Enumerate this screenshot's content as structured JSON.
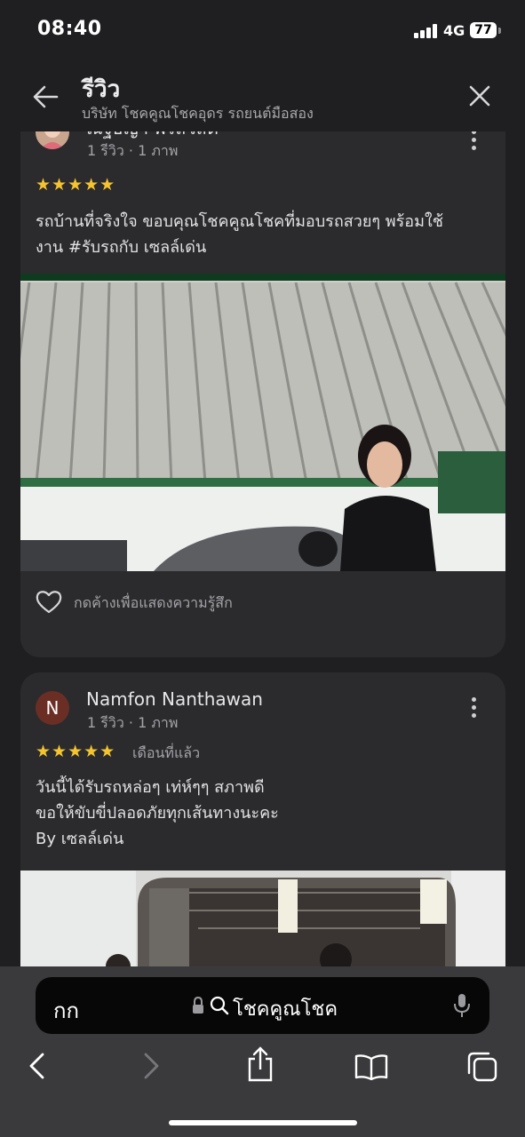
{
  "status_bar": {
    "time": "08:40",
    "network": "4G",
    "battery": "77"
  },
  "header": {
    "title": "รีวิว",
    "subtitle": "บริษัท โชคคูณโชคอุดร รถยนต์มือสอง",
    "back_icon": "arrow-left-icon",
    "close_icon": "close-icon"
  },
  "reviews": [
    {
      "name": "ณัฐธิญา พรสวัสดิ์",
      "meta": "1 รีวิว · 1 ภาพ",
      "rating": 5,
      "stars": "★★★★★",
      "ago": "",
      "text": "รถบ้านที่จริงใจ ขอบคุณโชคคูณโชคที่มอบรถสวยๆ พร้อมใช้\nงาน #รับรถกับ เซลล์เด่น",
      "like_label": "กดค้างเพื่อแสดงความรู้สึก"
    },
    {
      "avatar_letter": "N",
      "name": "Namfon Nanthawan",
      "meta": "1 รีวิว · 1 ภาพ",
      "rating": 5,
      "stars": "★★★★★",
      "ago": "เดือนที่แล้ว",
      "text": "วันนี้ได้รับรถหล่อๆ เท่ห์ๆๆ สภาพดี\nขอให้ขับขี่ปลอดภัยทุกเส้นทางนะคะ\nBy เซลล์เด่น"
    }
  ],
  "browser": {
    "aa_label": "กก",
    "url": "โชคคูณโชค",
    "icons": [
      "lock-icon",
      "search-icon",
      "microphone-icon",
      "back-icon",
      "forward-icon",
      "share-icon",
      "bookmarks-icon",
      "tabs-icon"
    ]
  },
  "colors": {
    "background": "#1f1f21",
    "card": "#2b2b2e",
    "star": "#f4c430",
    "avatar_n": "#6b2e24"
  }
}
